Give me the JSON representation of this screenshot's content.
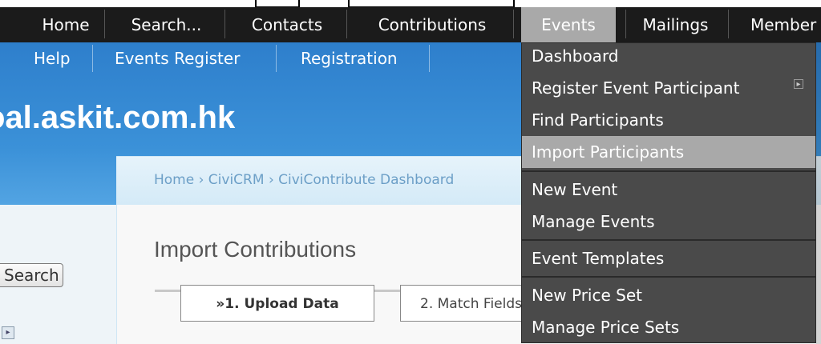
{
  "primary_nav": {
    "items": [
      {
        "label": "Home"
      },
      {
        "label": "Search..."
      },
      {
        "label": "Contacts"
      },
      {
        "label": "Contributions"
      },
      {
        "label": "Events",
        "active": true
      },
      {
        "label": "Mailings"
      },
      {
        "label": "Member"
      }
    ]
  },
  "secondary_nav": {
    "items": [
      {
        "label": "Help"
      },
      {
        "label": "Events Register"
      },
      {
        "label": "Registration"
      }
    ]
  },
  "site": {
    "title": "oal.askit.com.hk"
  },
  "breadcrumb": {
    "text": "Home › CiviCRM › CiviContribute Dashboard"
  },
  "page": {
    "title": "Import Contributions"
  },
  "wizard": {
    "steps": [
      {
        "label": "»1. Upload Data",
        "active": true
      },
      {
        "label": "2. Match Fields",
        "active": false
      }
    ]
  },
  "sidebar": {
    "search_button": "Search"
  },
  "events_menu": {
    "items": [
      {
        "label": "Dashboard"
      },
      {
        "label": "Register Event Participant",
        "has_submenu": true
      },
      {
        "label": "Find Participants"
      },
      {
        "label": "Import Participants",
        "highlighted": true
      },
      {
        "label": "New Event"
      },
      {
        "label": "Manage Events"
      },
      {
        "label": "Event Templates"
      },
      {
        "label": "New Price Set"
      },
      {
        "label": "Manage Price Sets"
      }
    ]
  },
  "colors": {
    "nav_background": "#1b1b1b",
    "active_item": "#a9a9a9",
    "dropdown_background": "#4a4a4a",
    "header_blue": "#3b91d8"
  }
}
